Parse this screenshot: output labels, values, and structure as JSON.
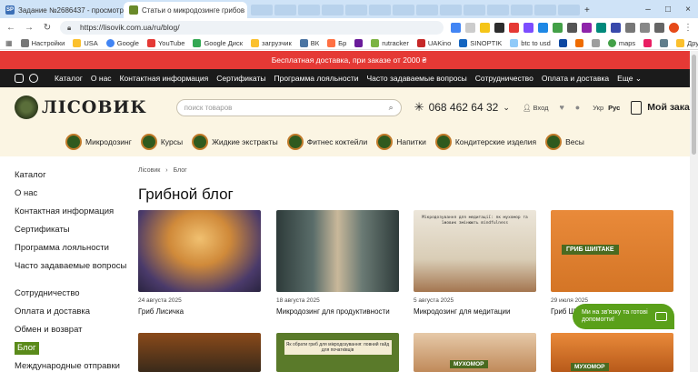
{
  "browser": {
    "tabs": [
      {
        "title": "Задание №2686437 - просмотр з",
        "favicon": "SP"
      },
      {
        "title": "Статьи о микродозинге грибов",
        "favicon": ""
      }
    ],
    "url": "https://lisovik.com.ua/ru/blog/",
    "bookmarks": [
      "Настройки",
      "USA",
      "Google",
      "YouTube",
      "Google Диск",
      "загрузчик",
      "ВК",
      "Бр",
      "rutracker",
      "UAKino",
      "SINOPTIK",
      "btc to usd",
      "maps",
      "Другие закладки"
    ]
  },
  "site": {
    "promo": "Бесплатная доставка, при заказе от 2000 ₴",
    "nav": [
      "Каталог",
      "О нас",
      "Контактная информация",
      "Сертификаты",
      "Программа лояльности",
      "Часто задаваемые вопросы",
      "Сотрудничество",
      "Оплата и доставка",
      "Еще"
    ],
    "logo_text": "ЛІСОВИК",
    "search_placeholder": "поиск товаров",
    "phone": "068 462 64 32",
    "login": "Вход",
    "lang_ua": "Укр",
    "lang_ru": "Рус",
    "cart": "Мой заказ",
    "categories": [
      "Микродозинг",
      "Курсы",
      "Жидкие экстракты",
      "Фитнес коктейли",
      "Напитки",
      "Кондитерские изделия",
      "Весы"
    ]
  },
  "sidebar": {
    "items": [
      "Каталог",
      "О нас",
      "Контактная информация",
      "Сертификаты",
      "Программа лояльности",
      "Часто задаваемые вопросы",
      "Сотрудничество",
      "Оплата и доставка",
      "Обмен и возврат",
      "Блог",
      "Международные отправки"
    ]
  },
  "blog": {
    "breadcrumb_home": "Лісовик",
    "breadcrumb_sep": "›",
    "breadcrumb_current": "Блог",
    "title": "Грибной блог",
    "posts": [
      {
        "date": "24 августа 2025",
        "title": "Гриб Лисичка",
        "img_text": ""
      },
      {
        "date": "18 августа 2025",
        "title": "Микродозинг для продуктивности",
        "img_text": ""
      },
      {
        "date": "5 августа 2025",
        "title": "Микродозинг для медитации",
        "img_text": "Мікродозування для медитації: як мухомор та їжовик змінюють mindfulness"
      },
      {
        "date": "29 июля 2025",
        "title": "Гриб Ши",
        "img_text": "ГРИБ ШИІТАКЕ"
      }
    ],
    "posts_row2_text": [
      "",
      "Як обрати гриб для мікродозування: повний гайд для початківців",
      "МУХОМОР",
      "МУХОМОР"
    ]
  },
  "chat": {
    "text": "Ми на зв'язку та готові допомогти!"
  }
}
